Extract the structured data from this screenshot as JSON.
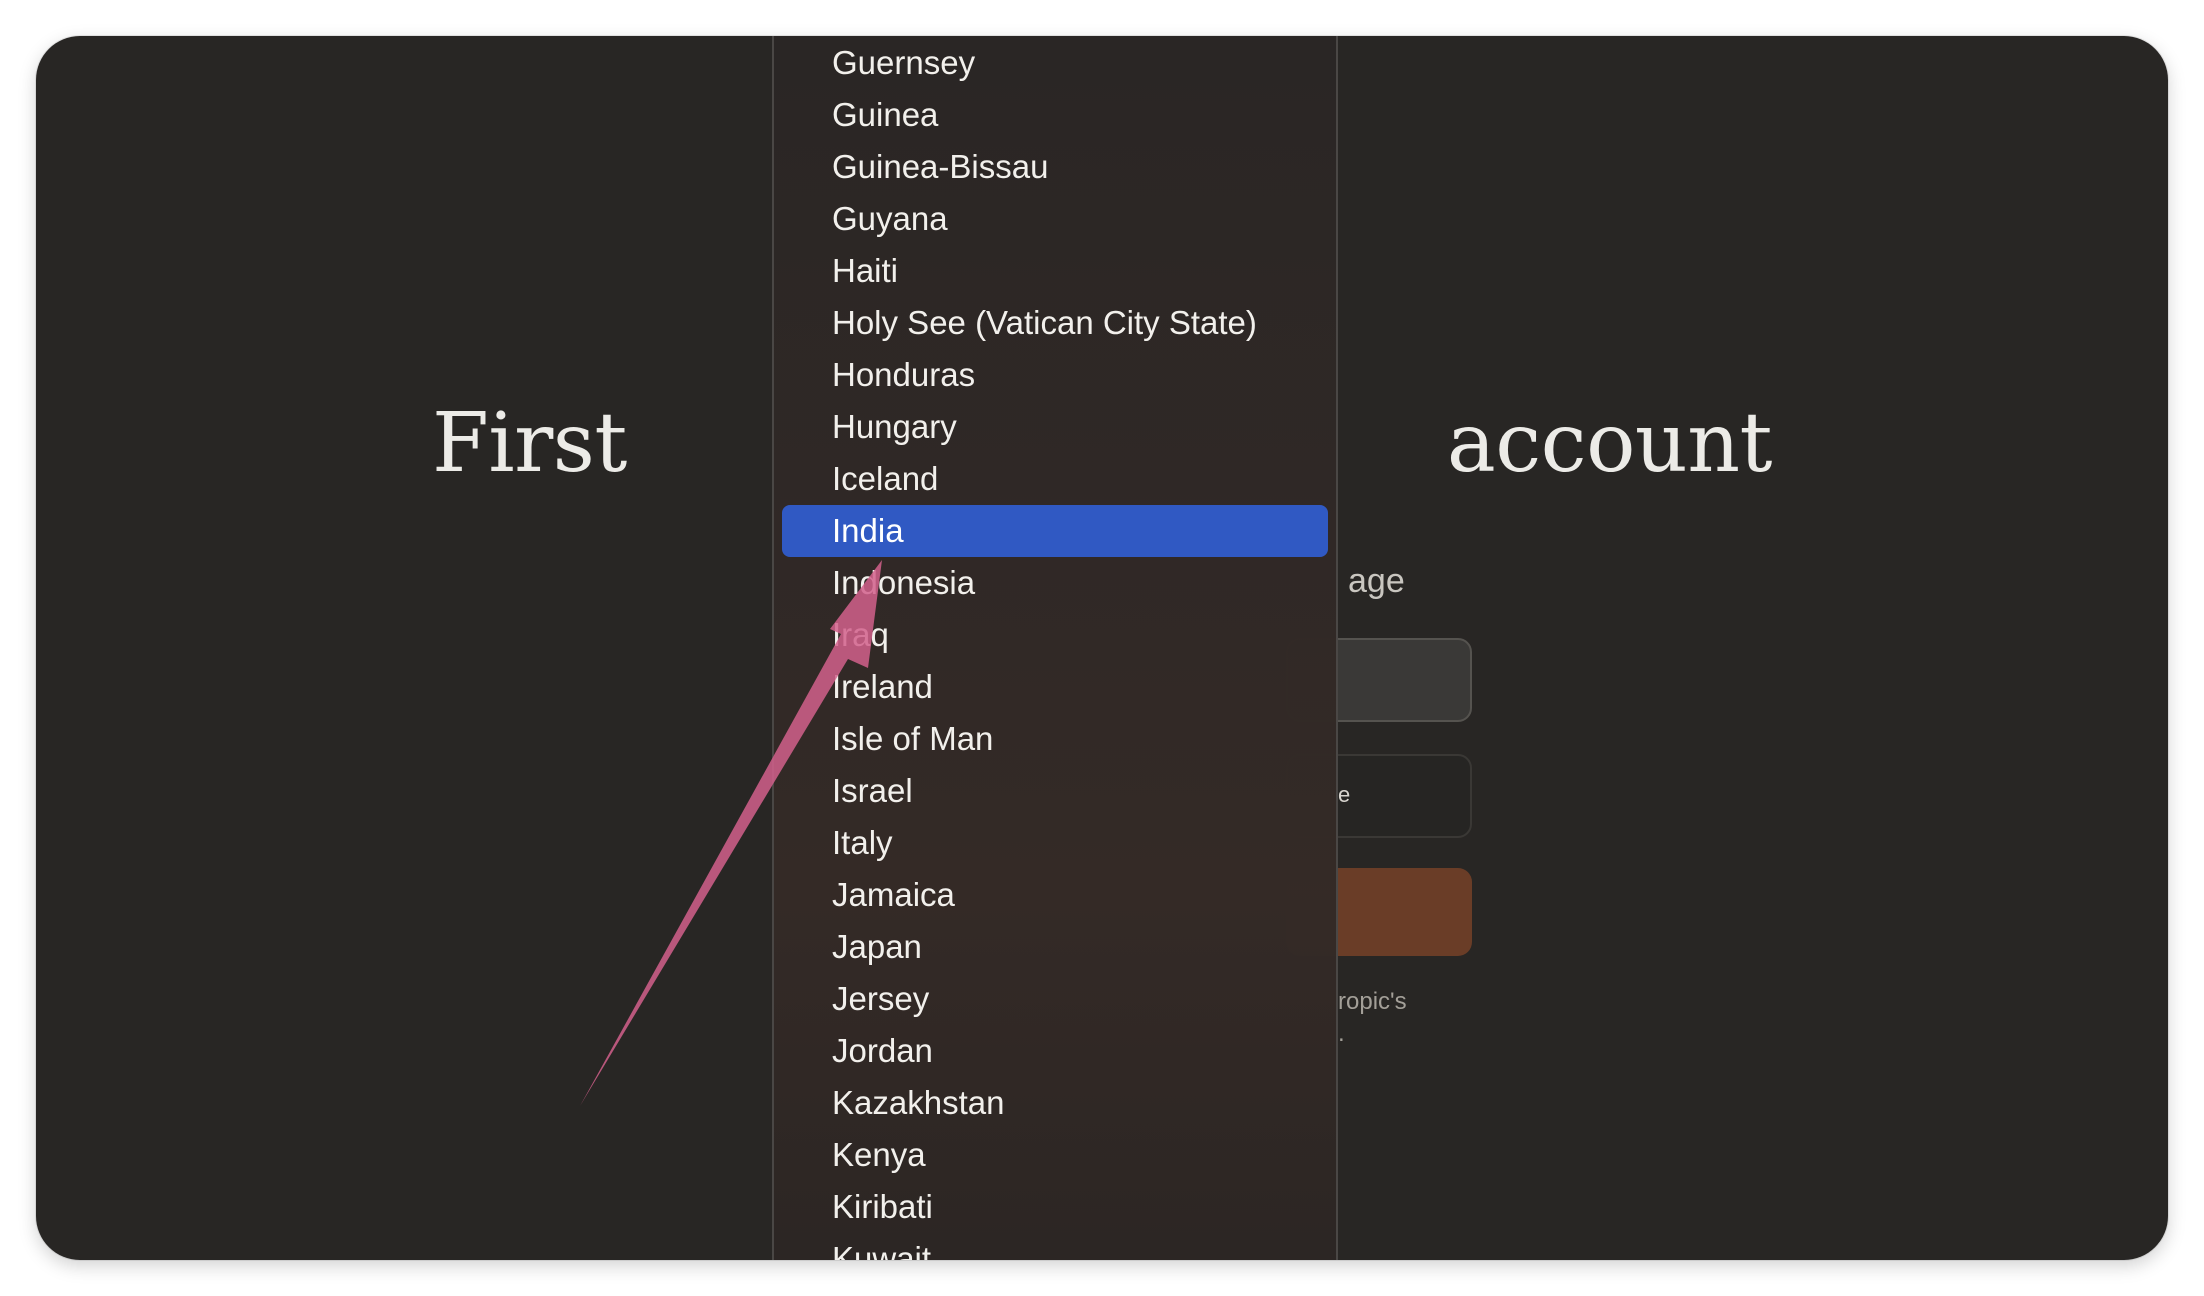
{
  "page": {
    "heading_left": "First",
    "heading_right": "account",
    "sub_label": "age",
    "field_fragment": "e",
    "legal_line1": "ropic's",
    "legal_line2": "."
  },
  "dropdown": {
    "selected": "India",
    "options": [
      "Guernsey",
      "Guinea",
      "Guinea-Bissau",
      "Guyana",
      "Haiti",
      "Holy See (Vatican City State)",
      "Honduras",
      "Hungary",
      "Iceland",
      "India",
      "Indonesia",
      "Iraq",
      "Ireland",
      "Isle of Man",
      "Israel",
      "Italy",
      "Jamaica",
      "Japan",
      "Jersey",
      "Jordan",
      "Kazakhstan",
      "Kenya",
      "Kiribati",
      "Kuwait"
    ]
  },
  "colors": {
    "background": "#282624",
    "selection": "#3059c3",
    "annotation_arrow": "#d2608c",
    "primary_button": "#6a3d27"
  },
  "annotation": {
    "icon": "pointer-arrow-icon",
    "points_to": "India"
  }
}
